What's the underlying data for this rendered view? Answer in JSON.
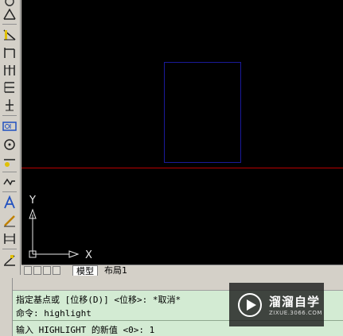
{
  "canvas": {
    "ucs_y_label": "Y",
    "ucs_x_label": "X",
    "crosshair_color": "#b80000",
    "rect_color": "#1a1a9a"
  },
  "tabs": [
    {
      "label": "模型",
      "active": true
    },
    {
      "label": "布局1",
      "active": false
    }
  ],
  "command": {
    "line1": "指定基点或 [位移(D)] <位移>:  *取消*",
    "line2": "命令: highlight",
    "line3": "输入 HIGHLIGHT 的新值 <0>: 1"
  },
  "toolbar": {
    "tools": [
      "point-icon",
      "arc-dimension-icon",
      "aligned-dimension-icon",
      "linear-dimension-icon",
      "baseline-dimension-icon",
      "continue-dimension-icon",
      "ordinate-dimension-icon",
      "tolerance-icon",
      "center-mark-icon",
      "quick-leader-icon",
      "jogged-icon",
      "dimension-text-icon",
      "dimension-edit-icon",
      "dimension-update-icon",
      "oblique-icon"
    ]
  },
  "watermark": {
    "title": "溜溜自学",
    "subtitle": "ZIXUE.3066.COM"
  }
}
